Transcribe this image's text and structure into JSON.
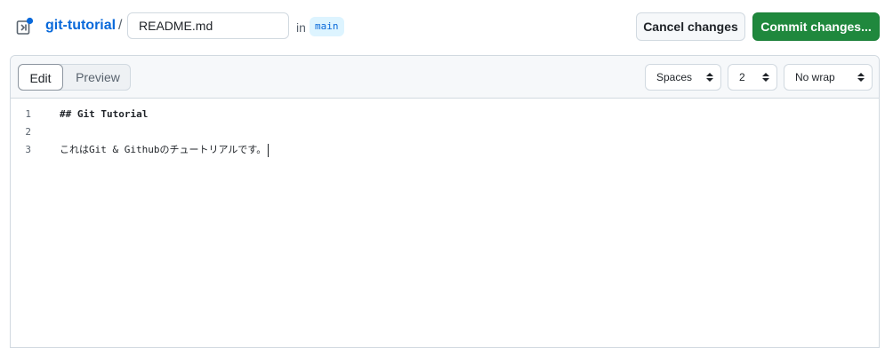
{
  "header": {
    "repo_name": "git-tutorial",
    "separator": "/",
    "file_name": "README.md",
    "in_label": "in",
    "branch": "main",
    "cancel_label": "Cancel changes",
    "commit_label": "Commit changes..."
  },
  "editor": {
    "tabs": [
      {
        "label": "Edit",
        "active": true
      },
      {
        "label": "Preview",
        "active": false
      }
    ],
    "indent_mode": "Spaces",
    "indent_size": "2",
    "wrap_mode": "No wrap",
    "lines": [
      {
        "number": "1",
        "text": "## Git Tutorial"
      },
      {
        "number": "2",
        "text": ""
      },
      {
        "number": "3",
        "text": "これはGit & Githubのチュートリアルです。"
      }
    ]
  },
  "colors": {
    "link": "#0969da",
    "commit_button": "#1f883d",
    "branch_bg": "#ddf4ff"
  }
}
